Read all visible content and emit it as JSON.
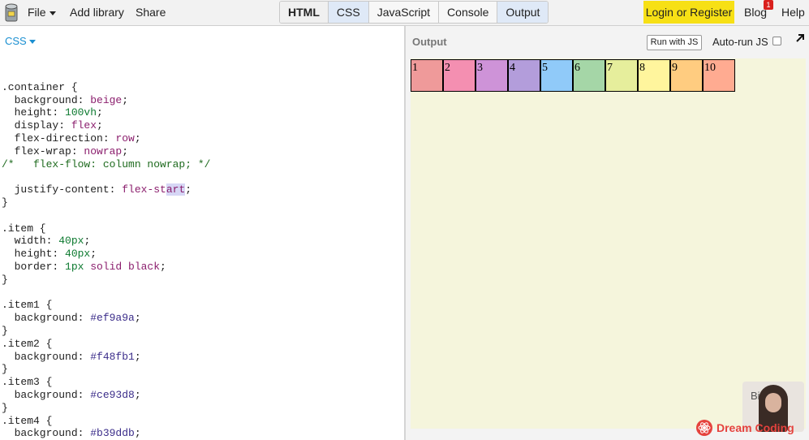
{
  "toolbar": {
    "logo_icon": "jsbin-logo-icon",
    "file_label": "File",
    "add_library_label": "Add library",
    "share_label": "Share",
    "tabs": [
      {
        "label": "HTML",
        "state": "bold"
      },
      {
        "label": "CSS",
        "state": "active"
      },
      {
        "label": "JavaScript",
        "state": "normal"
      },
      {
        "label": "Console",
        "state": "normal"
      },
      {
        "label": "Output",
        "state": "active"
      }
    ],
    "login_label": "Login or Register",
    "blog_label": "Blog",
    "blog_badge": "1",
    "help_label": "Help",
    "accent_color": "#f7e015"
  },
  "editor": {
    "language": "CSS",
    "code_lines": [
      "",
      ".container {",
      "  background: beige;",
      "  height: 100vh;",
      "  display: flex;",
      "  flex-direction: row;",
      "  flex-wrap: nowrap;",
      "/*   flex-flow: column nowrap; */",
      "",
      "  justify-content: flex-start;",
      "}",
      "",
      ".item {",
      "  width: 40px;",
      "  height: 40px;",
      "  border: 1px solid black;",
      "}",
      "",
      ".item1 {",
      "  background: #ef9a9a;",
      "}",
      ".item2 {",
      "  background: #f48fb1;",
      "}",
      ".item3 {",
      "  background: #ce93d8;",
      "}",
      ".item4 {",
      "  background: #b39ddb;"
    ]
  },
  "output": {
    "title": "Output",
    "run_label": "Run with JS",
    "autorun_label": "Auto-run JS",
    "expand_icon": "expand-arrow-icon",
    "items": [
      {
        "label": "1",
        "color": "#ef9a9a"
      },
      {
        "label": "2",
        "color": "#f48fb1"
      },
      {
        "label": "3",
        "color": "#ce93d8"
      },
      {
        "label": "4",
        "color": "#b39ddb"
      },
      {
        "label": "5",
        "color": "#90caf9"
      },
      {
        "label": "6",
        "color": "#a5d6a7"
      },
      {
        "label": "7",
        "color": "#e6ee9c"
      },
      {
        "label": "8",
        "color": "#fff59d"
      },
      {
        "label": "9",
        "color": "#ffcc80"
      },
      {
        "label": "10",
        "color": "#ffab91"
      }
    ]
  },
  "overlay": {
    "webcam_text": "Bin info",
    "brand": "Dream Coding"
  }
}
